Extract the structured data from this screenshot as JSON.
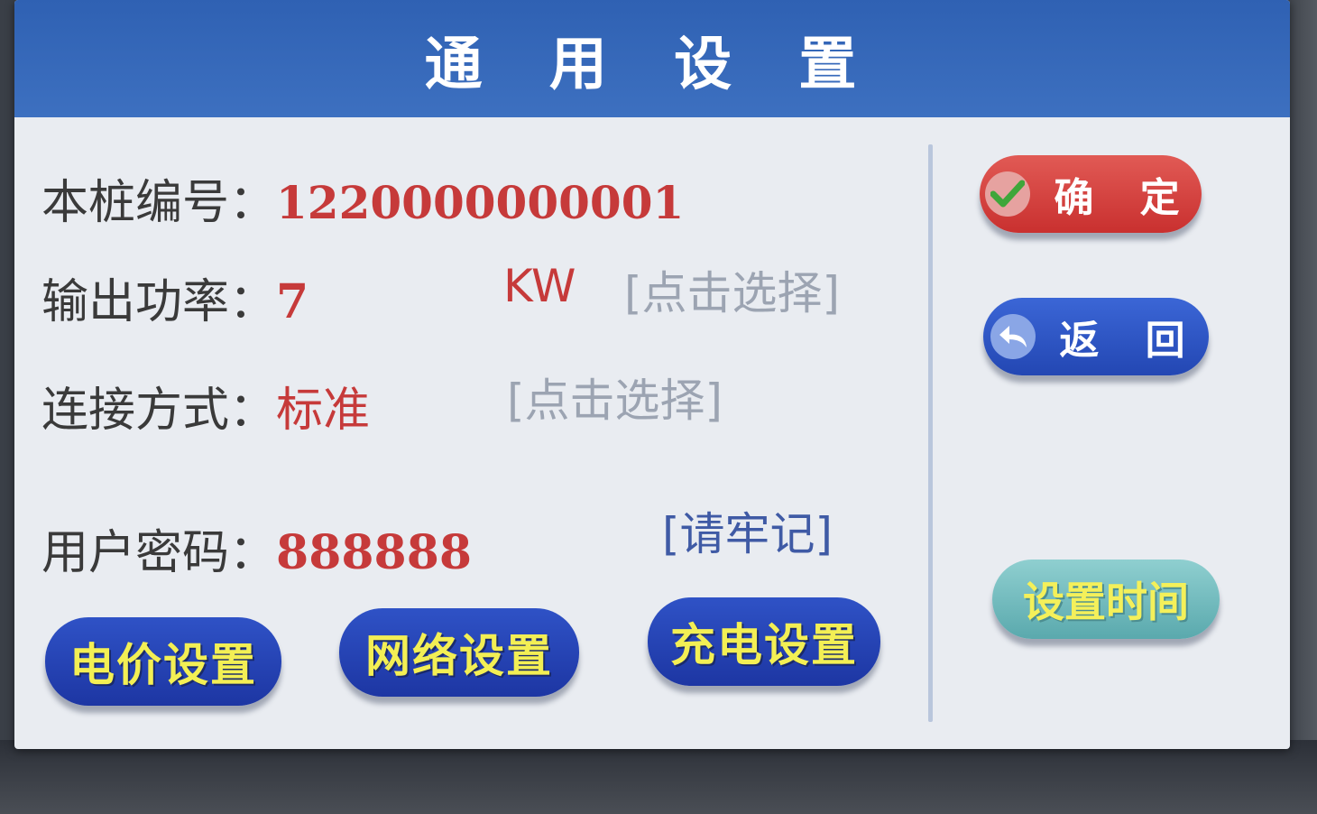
{
  "screen": {
    "title": "通 用 设 置"
  },
  "fields": {
    "pile_id": {
      "label": "本桩编号：",
      "value": "1220000000001"
    },
    "output_power": {
      "label": "输出功率：",
      "value": "7",
      "unit": "KW",
      "hint": "[点击选择]"
    },
    "connection": {
      "label": "连接方式：",
      "value": "标准",
      "hint": "[点击选择]"
    },
    "password": {
      "label": "用户密码：",
      "value": "888888",
      "hint": "[请牢记]"
    }
  },
  "buttons": {
    "confirm": "确 定",
    "back": "返 回",
    "set_time": "设置时间",
    "price_settings": "电价设置",
    "network_settings": "网络设置",
    "charging_settings": "充电设置"
  },
  "icons": {
    "confirm": "checkmark-icon",
    "back": "back-arrow-icon"
  },
  "colors": {
    "titlebar": "#2f61b3",
    "value_red": "#c63a3a",
    "confirm_red": "#d6403d",
    "back_blue": "#2f57c7",
    "nav_blue": "#2441b0",
    "nav_text_yellow": "#f3ef54",
    "set_time_teal": "#74bfc1"
  }
}
